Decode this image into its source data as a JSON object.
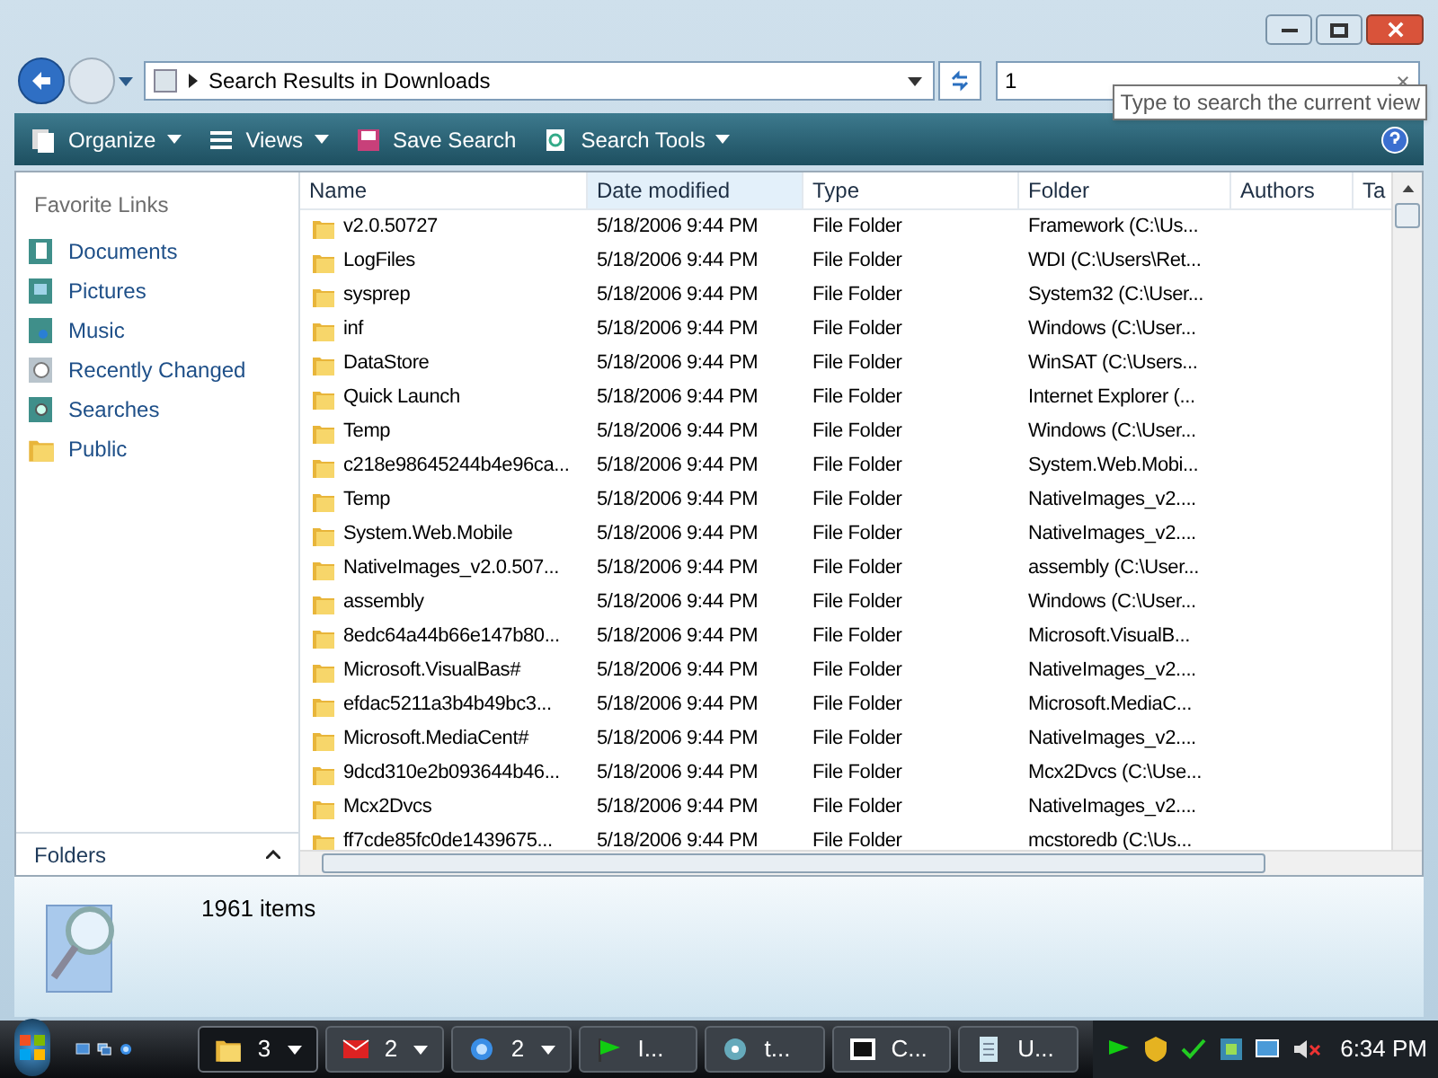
{
  "address": {
    "breadcrumb": "Search Results in Downloads"
  },
  "search": {
    "value": "1",
    "tooltip": "Type to search the current view"
  },
  "toolbar": [
    {
      "label": "Organize",
      "kind": "organize",
      "dropdown": true
    },
    {
      "label": "Views",
      "kind": "views",
      "dropdown": true
    },
    {
      "label": "Save Search",
      "kind": "save",
      "dropdown": false
    },
    {
      "label": "Search Tools",
      "kind": "tools",
      "dropdown": true
    }
  ],
  "sidebar": {
    "title": "Favorite Links",
    "items": [
      {
        "label": "Documents",
        "kind": "documents"
      },
      {
        "label": "Pictures",
        "kind": "pictures"
      },
      {
        "label": "Music",
        "kind": "music"
      },
      {
        "label": "Recently Changed",
        "kind": "recent"
      },
      {
        "label": "Searches",
        "kind": "searches"
      },
      {
        "label": "Public",
        "kind": "folder"
      }
    ],
    "folders_label": "Folders"
  },
  "table": {
    "columns": [
      {
        "label": "Name",
        "sorted": false
      },
      {
        "label": "Date modified",
        "sorted": true
      },
      {
        "label": "Type",
        "sorted": false
      },
      {
        "label": "Folder",
        "sorted": false
      },
      {
        "label": "Authors",
        "sorted": false
      },
      {
        "label": "Ta",
        "sorted": false
      }
    ],
    "rows": [
      {
        "name": "v2.0.50727",
        "date": "5/18/2006 9:44 PM",
        "type": "File Folder",
        "folder": "Framework (C:\\Us..."
      },
      {
        "name": "LogFiles",
        "date": "5/18/2006 9:44 PM",
        "type": "File Folder",
        "folder": "WDI (C:\\Users\\Ret..."
      },
      {
        "name": "sysprep",
        "date": "5/18/2006 9:44 PM",
        "type": "File Folder",
        "folder": "System32 (C:\\User..."
      },
      {
        "name": "inf",
        "date": "5/18/2006 9:44 PM",
        "type": "File Folder",
        "folder": "Windows (C:\\User..."
      },
      {
        "name": "DataStore",
        "date": "5/18/2006 9:44 PM",
        "type": "File Folder",
        "folder": "WinSAT (C:\\Users..."
      },
      {
        "name": "Quick Launch",
        "date": "5/18/2006 9:44 PM",
        "type": "File Folder",
        "folder": "Internet Explorer (..."
      },
      {
        "name": "Temp",
        "date": "5/18/2006 9:44 PM",
        "type": "File Folder",
        "folder": "Windows (C:\\User..."
      },
      {
        "name": "c218e98645244b4e96ca...",
        "date": "5/18/2006 9:44 PM",
        "type": "File Folder",
        "folder": "System.Web.Mobi..."
      },
      {
        "name": "Temp",
        "date": "5/18/2006 9:44 PM",
        "type": "File Folder",
        "folder": "NativeImages_v2...."
      },
      {
        "name": "System.Web.Mobile",
        "date": "5/18/2006 9:44 PM",
        "type": "File Folder",
        "folder": "NativeImages_v2...."
      },
      {
        "name": "NativeImages_v2.0.507...",
        "date": "5/18/2006 9:44 PM",
        "type": "File Folder",
        "folder": "assembly (C:\\User..."
      },
      {
        "name": "assembly",
        "date": "5/18/2006 9:44 PM",
        "type": "File Folder",
        "folder": "Windows (C:\\User..."
      },
      {
        "name": "8edc64a44b66e147b80...",
        "date": "5/18/2006 9:44 PM",
        "type": "File Folder",
        "folder": "Microsoft.VisualB..."
      },
      {
        "name": "Microsoft.VisualBas#",
        "date": "5/18/2006 9:44 PM",
        "type": "File Folder",
        "folder": "NativeImages_v2...."
      },
      {
        "name": "efdac5211a3b4b49bc3...",
        "date": "5/18/2006 9:44 PM",
        "type": "File Folder",
        "folder": "Microsoft.MediaC..."
      },
      {
        "name": "Microsoft.MediaCent#",
        "date": "5/18/2006 9:44 PM",
        "type": "File Folder",
        "folder": "NativeImages_v2...."
      },
      {
        "name": "9dcd310e2b093644b46...",
        "date": "5/18/2006 9:44 PM",
        "type": "File Folder",
        "folder": "Mcx2Dvcs (C:\\Use..."
      },
      {
        "name": "Mcx2Dvcs",
        "date": "5/18/2006 9:44 PM",
        "type": "File Folder",
        "folder": "NativeImages_v2...."
      },
      {
        "name": "ff7cde85fc0de1439675...",
        "date": "5/18/2006 9:44 PM",
        "type": "File Folder",
        "folder": "mcstoredb (C:\\Us..."
      }
    ]
  },
  "status": {
    "count": "1961 items"
  },
  "taskbar": {
    "buttons": [
      {
        "label": "3",
        "kind": "folder",
        "dropdown": true,
        "selected": true
      },
      {
        "label": "2",
        "kind": "mail",
        "dropdown": true,
        "selected": false
      },
      {
        "label": "2",
        "kind": "browser",
        "dropdown": true,
        "selected": false
      },
      {
        "label": "I...",
        "kind": "flag",
        "dropdown": false,
        "selected": false
      },
      {
        "label": "t...",
        "kind": "disc",
        "dropdown": false,
        "selected": false
      },
      {
        "label": "C...",
        "kind": "archive",
        "dropdown": false,
        "selected": false
      },
      {
        "label": "U...",
        "kind": "notepad",
        "dropdown": false,
        "selected": false
      }
    ],
    "clock": "6:34 PM"
  }
}
